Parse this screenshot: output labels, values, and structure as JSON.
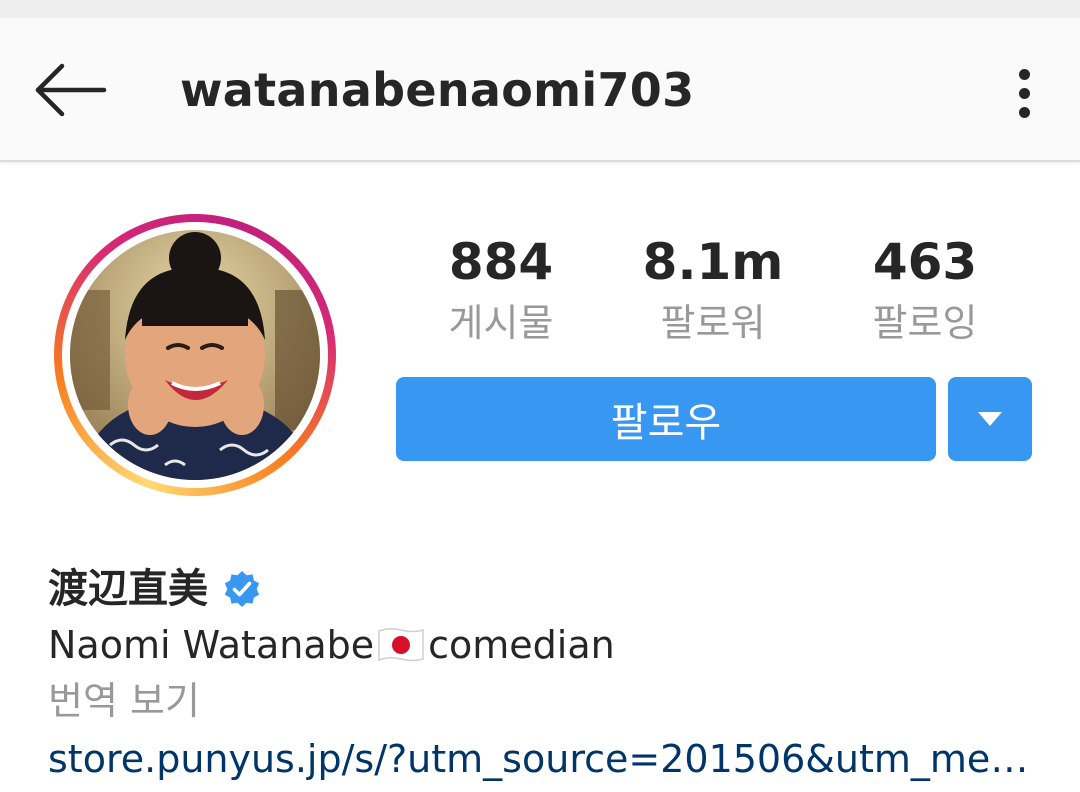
{
  "header": {
    "username": "watanabenaomi703",
    "back_icon": "arrow-left-icon",
    "more_icon": "more-vertical-icon"
  },
  "profile": {
    "avatar_icon": "profile-photo",
    "stats": [
      {
        "value": "884",
        "label": "게시물"
      },
      {
        "value": "8.1m",
        "label": "팔로워"
      },
      {
        "value": "463",
        "label": "팔로잉"
      }
    ],
    "follow_label": "팔로우",
    "dropdown_icon": "caret-down-icon",
    "display_name": "渡辺直美",
    "verified_icon": "verified-badge-icon",
    "bio_name": "Naomi Watanabe",
    "bio_flag_icon": "japan-flag-icon",
    "bio_role": "comedian",
    "translate_label": "번역 보기",
    "link": "store.punyus.jp/s/?utm_source=201506&utm_med…"
  },
  "colors": {
    "accent_blue": "#3897f0",
    "link_blue": "#003569",
    "text_primary": "#262626",
    "text_secondary": "#999999"
  }
}
